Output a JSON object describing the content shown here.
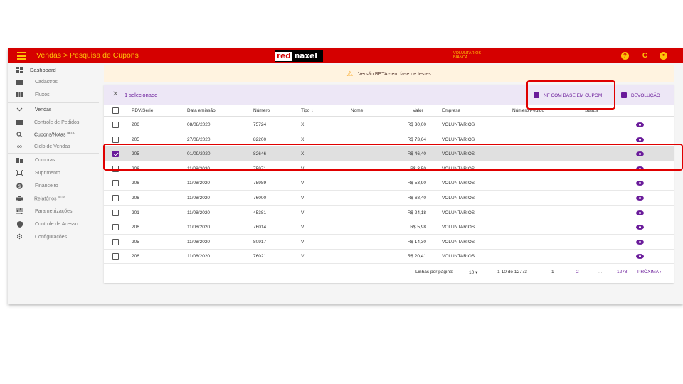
{
  "topbar": {
    "title": "Vendas > Pesquisa de Cupons",
    "logo_red": "red",
    "logo_naxel": "naxel",
    "user_line1": "VOLUNTARIOS",
    "user_line2": "BIANCA",
    "help_glyph": "?",
    "refresh_glyph": "C",
    "account_glyph": "●",
    "color_bar": "#d50000",
    "color_accent": "#ffc107"
  },
  "sidebar": {
    "items": [
      {
        "label": "Dashboard",
        "icon": "dashboard-icon"
      },
      {
        "label": "Cadastros",
        "icon": "folder-icon"
      },
      {
        "label": "Fluxos",
        "icon": "columns-icon"
      },
      {
        "label": "Vendas",
        "icon": "chevron-down-icon"
      },
      {
        "label": "Controle de Pedidos",
        "icon": "list-icon"
      },
      {
        "label": "Cupons/Notas",
        "badge": "BETA",
        "icon": "search-receipt-icon"
      },
      {
        "label": "Ciclo de Vendas",
        "icon": "infinity-icon"
      },
      {
        "label": "Compras",
        "icon": "store-icon"
      },
      {
        "label": "Suprimento",
        "icon": "expand-icon"
      },
      {
        "label": "Financeiro",
        "icon": "money-icon"
      },
      {
        "label": "Relatórios",
        "badge": "BETA",
        "icon": "printer-icon"
      },
      {
        "label": "Parametrizações",
        "icon": "sliders-icon"
      },
      {
        "label": "Controle de Acesso",
        "icon": "shield-icon"
      },
      {
        "label": "Configurações",
        "icon": "gear-icon"
      }
    ]
  },
  "beta_banner": {
    "text": "Versão BETA - em fase de testes",
    "icon": "warning-icon"
  },
  "selection": {
    "close_glyph": "✕",
    "count_label": "1 selecionado",
    "nf_button": "NF COM BASE EM CUPOM",
    "devolucao_button": "DEVOLUÇÃO"
  },
  "table": {
    "headers": {
      "pdv": "PDV/Serie",
      "data": "Data emissão",
      "numero": "Número",
      "tipo": "Tipo ↓",
      "nome": "Nome",
      "valor": "Valor",
      "empresa": "Empresa",
      "pedido": "Número Pedido",
      "status": "Status"
    },
    "rows": [
      {
        "pdv": "206",
        "data": "08/08/2020",
        "numero": "75724",
        "tipo": "X",
        "valor": "R$ 30,00",
        "empresa": "VOLUNTARIOS",
        "selected": false
      },
      {
        "pdv": "205",
        "data": "27/08/2020",
        "numero": "82200",
        "tipo": "X",
        "valor": "R$ 73,64",
        "empresa": "VOLUNTARIOS",
        "selected": false
      },
      {
        "pdv": "205",
        "data": "01/09/2020",
        "numero": "82646",
        "tipo": "X",
        "valor": "R$ 46,40",
        "empresa": "VOLUNTARIOS",
        "selected": true
      },
      {
        "pdv": "206",
        "data": "11/08/2020",
        "numero": "75971",
        "tipo": "V",
        "valor": "R$ 3,50",
        "empresa": "VOLUNTARIOS",
        "selected": false
      },
      {
        "pdv": "206",
        "data": "11/08/2020",
        "numero": "75989",
        "tipo": "V",
        "valor": "R$ 53,90",
        "empresa": "VOLUNTARIOS",
        "selected": false
      },
      {
        "pdv": "206",
        "data": "11/08/2020",
        "numero": "76000",
        "tipo": "V",
        "valor": "R$ 68,40",
        "empresa": "VOLUNTARIOS",
        "selected": false
      },
      {
        "pdv": "201",
        "data": "11/08/2020",
        "numero": "45381",
        "tipo": "V",
        "valor": "R$ 24,18",
        "empresa": "VOLUNTARIOS",
        "selected": false
      },
      {
        "pdv": "206",
        "data": "11/08/2020",
        "numero": "76014",
        "tipo": "V",
        "valor": "R$ 5,98",
        "empresa": "VOLUNTARIOS",
        "selected": false
      },
      {
        "pdv": "205",
        "data": "11/08/2020",
        "numero": "80917",
        "tipo": "V",
        "valor": "R$ 14,30",
        "empresa": "VOLUNTARIOS",
        "selected": false
      },
      {
        "pdv": "206",
        "data": "11/08/2020",
        "numero": "76021",
        "tipo": "V",
        "valor": "R$ 20,41",
        "empresa": "VOLUNTARIOS",
        "selected": false
      }
    ]
  },
  "pagination": {
    "rows_per_page_label": "Linhas por página:",
    "rows_per_page_value": "10 ▾",
    "range": "1-10 de 12773",
    "page1": "1",
    "page2": "2",
    "ellipsis": "...",
    "last_page": "1278",
    "next": "PRÓXIMA ›"
  },
  "colors": {
    "primary": "#6a1b9a",
    "highlight": "#e00000"
  }
}
